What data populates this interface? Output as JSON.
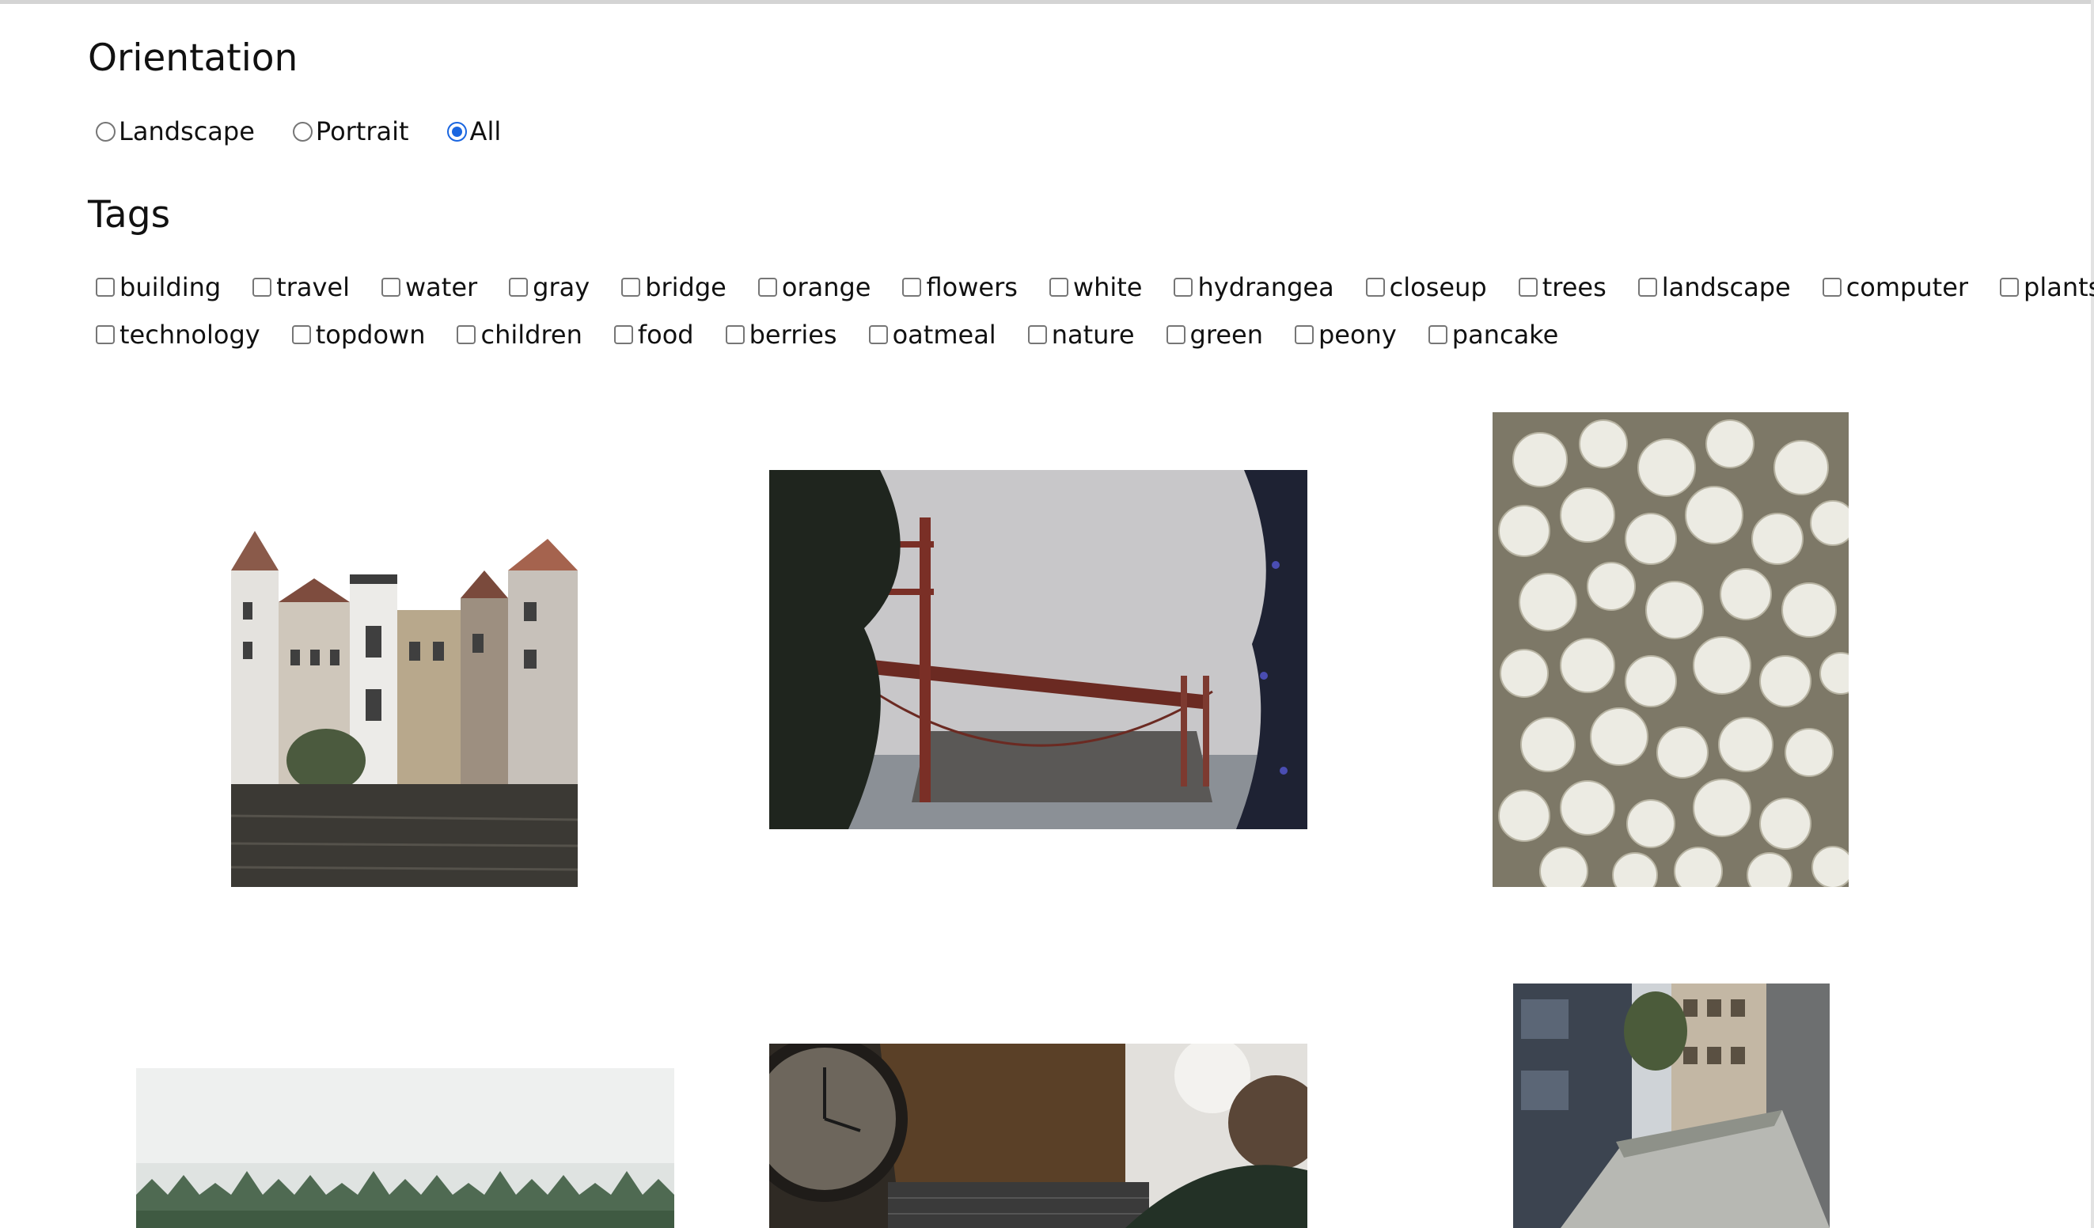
{
  "orientation": {
    "heading": "Orientation",
    "options": [
      {
        "label": "Landscape",
        "checked": false
      },
      {
        "label": "Portrait",
        "checked": false
      },
      {
        "label": "All",
        "checked": true
      }
    ]
  },
  "tags": {
    "heading": "Tags",
    "items": [
      "building",
      "travel",
      "water",
      "gray",
      "bridge",
      "orange",
      "flowers",
      "white",
      "hydrangea",
      "closeup",
      "trees",
      "landscape",
      "computer",
      "plants",
      "technology",
      "topdown",
      "children",
      "food",
      "berries",
      "oatmeal",
      "nature",
      "green",
      "peony",
      "pancake"
    ]
  },
  "gallery": {
    "photos": [
      {
        "subject": "canal buildings",
        "orientation": "portrait"
      },
      {
        "subject": "foggy suspension bridge",
        "orientation": "landscape"
      },
      {
        "subject": "white hydrangea closeup",
        "orientation": "portrait"
      },
      {
        "subject": "misty forest",
        "orientation": "landscape"
      },
      {
        "subject": "desk with clock and laptop (top down)",
        "orientation": "landscape"
      },
      {
        "subject": "alley between buildings",
        "orientation": "portrait"
      }
    ]
  }
}
